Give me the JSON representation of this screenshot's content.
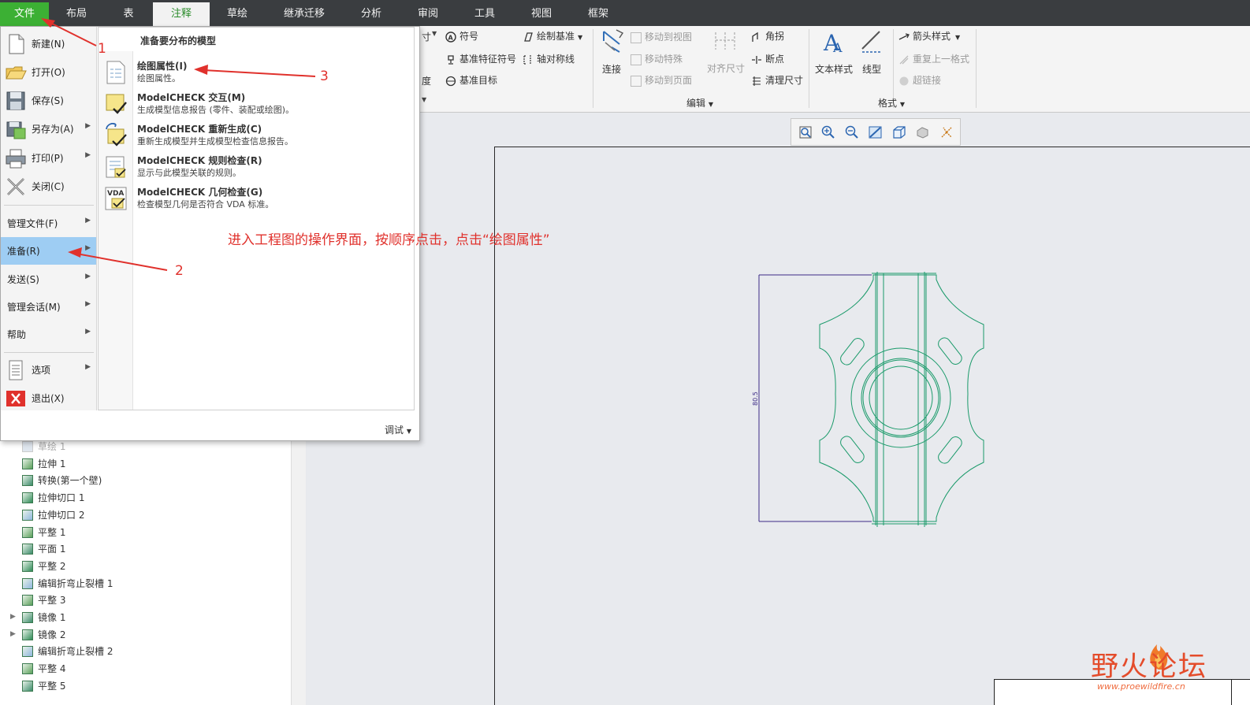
{
  "tabs": [
    "文件",
    "布局",
    "表",
    "注释",
    "草绘",
    "继承迁移",
    "分析",
    "审阅",
    "工具",
    "视图",
    "框架"
  ],
  "active_tab": "注释",
  "ribbon": {
    "col1": [
      "寸",
      "度"
    ],
    "col2": [
      "符号",
      "基准特征符号",
      "基准目标"
    ],
    "col3": [
      "绘制基准",
      "轴对称线"
    ],
    "connect": "连接",
    "edit_items": [
      "移动到视图",
      "移动特殊",
      "移动到页面"
    ],
    "align_dims": "对齐尺寸",
    "edit_items2": [
      "角拐",
      "断点",
      "清理尺寸"
    ],
    "edit_group": "编辑",
    "text_style": "文本样式",
    "line_type": "线型",
    "format_items": [
      "箭头样式",
      "重复上一格式",
      "超链接"
    ],
    "format_group": "格式"
  },
  "file_menu": {
    "items": [
      {
        "label": "新建(N)",
        "icon": "new-file-icon",
        "arrow": false
      },
      {
        "label": "打开(O)",
        "icon": "open-folder-icon",
        "arrow": false
      },
      {
        "label": "保存(S)",
        "icon": "save-disk-icon",
        "arrow": false
      },
      {
        "label": "另存为(A)",
        "icon": "save-as-icon",
        "arrow": true
      },
      {
        "label": "打印(P)",
        "icon": "printer-icon",
        "arrow": true
      },
      {
        "label": "关闭(C)",
        "icon": "close-x-icon",
        "arrow": false
      }
    ],
    "items2": [
      {
        "label": "管理文件(F)",
        "arrow": true
      },
      {
        "label": "准备(R)",
        "arrow": true
      },
      {
        "label": "发送(S)",
        "arrow": true
      },
      {
        "label": "管理会话(M)",
        "arrow": true
      },
      {
        "label": "帮助",
        "arrow": true
      }
    ],
    "options": "选项",
    "exit": "退出(X)",
    "panel_header": "准备要分布的模型",
    "panel_items": [
      {
        "title": "绘图属性(I)",
        "desc": "绘图属性。"
      },
      {
        "title": "ModelCHECK 交互(M)",
        "desc": "生成模型信息报告 (零件、装配或绘图)。"
      },
      {
        "title": "ModelCHECK 重新生成(C)",
        "desc": "重新生成模型并生成模型检查信息报告。"
      },
      {
        "title": "ModelCHECK 规则检查(R)",
        "desc": "显示与此模型关联的规则。"
      },
      {
        "title": "ModelCHECK 几何检查(G)",
        "desc": "检查模型几何是否符合 VDA 标准。"
      }
    ],
    "debug": "调试"
  },
  "tree": [
    {
      "label": "草绘 1",
      "dim": true
    },
    {
      "label": "拉伸 1"
    },
    {
      "label": "转换(第一个壁)"
    },
    {
      "label": "拉伸切口 1"
    },
    {
      "label": "拉伸切口 2"
    },
    {
      "label": "平整 1"
    },
    {
      "label": "平面 1"
    },
    {
      "label": "平整 2"
    },
    {
      "label": "编辑折弯止裂槽 1"
    },
    {
      "label": "平整 3"
    },
    {
      "label": "镜像 1",
      "expandable": true
    },
    {
      "label": "镜像 2",
      "expandable": true
    },
    {
      "label": "编辑折弯止裂槽 2"
    },
    {
      "label": "平整 4"
    },
    {
      "label": "平整 5"
    }
  ],
  "annotations": {
    "n1": "1",
    "n2": "2",
    "n3": "3",
    "instruction": "进入工程图的操作界面，按顺序点击，点击“绘图属性”"
  },
  "drawing": {
    "dimension": "80.5"
  },
  "watermark": {
    "text": "野火论坛",
    "url": "www.proewildfire.cn"
  },
  "colors": {
    "file_tab": "#3cb034",
    "selection": "#9ecdf3",
    "annotation": "#e0312c",
    "geometry": "#1a9a6a",
    "dimension": "#3b2a86"
  }
}
